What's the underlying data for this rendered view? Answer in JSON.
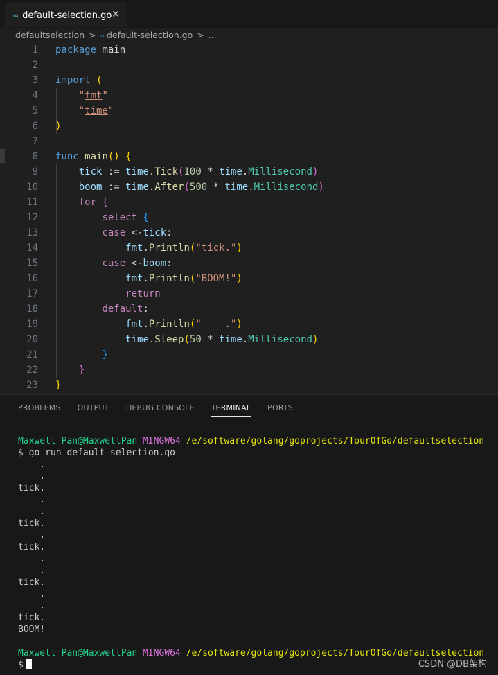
{
  "tab": {
    "icon": "go-file-icon",
    "title": "default-selection.go",
    "close": "✕"
  },
  "breadcrumb": {
    "folder": "defaultselection",
    "sep": ">",
    "file": "default-selection.go",
    "sep2": ">",
    "ellipsis": "..."
  },
  "code": [
    [
      [
        "kw",
        "package"
      ],
      [
        "op",
        " main"
      ]
    ],
    [],
    [
      [
        "kw",
        "import"
      ],
      [
        "op",
        " "
      ],
      [
        "p1",
        "("
      ]
    ],
    [
      [
        "op",
        "    "
      ],
      [
        "str",
        "\""
      ],
      [
        "strl",
        "fmt"
      ],
      [
        "str",
        "\""
      ]
    ],
    [
      [
        "op",
        "    "
      ],
      [
        "str",
        "\""
      ],
      [
        "strl",
        "time"
      ],
      [
        "str",
        "\""
      ]
    ],
    [
      [
        "p1",
        ")"
      ]
    ],
    [],
    [
      [
        "kw",
        "func"
      ],
      [
        "op",
        " "
      ],
      [
        "fn",
        "main"
      ],
      [
        "p1",
        "()"
      ],
      [
        "op",
        " "
      ],
      [
        "p1",
        "{"
      ]
    ],
    [
      [
        "op",
        "    "
      ],
      [
        "id",
        "tick"
      ],
      [
        "op",
        " := "
      ],
      [
        "id",
        "time"
      ],
      [
        "op",
        "."
      ],
      [
        "fn",
        "Tick"
      ],
      [
        "p2",
        "("
      ],
      [
        "num",
        "100"
      ],
      [
        "op",
        " * "
      ],
      [
        "id",
        "time"
      ],
      [
        "op",
        "."
      ],
      [
        "ty",
        "Millisecond"
      ],
      [
        "p2",
        ")"
      ]
    ],
    [
      [
        "op",
        "    "
      ],
      [
        "id",
        "boom"
      ],
      [
        "op",
        " := "
      ],
      [
        "id",
        "time"
      ],
      [
        "op",
        "."
      ],
      [
        "fn",
        "After"
      ],
      [
        "p2",
        "("
      ],
      [
        "num",
        "500"
      ],
      [
        "op",
        " * "
      ],
      [
        "id",
        "time"
      ],
      [
        "op",
        "."
      ],
      [
        "ty",
        "Millisecond"
      ],
      [
        "p2",
        ")"
      ]
    ],
    [
      [
        "op",
        "    "
      ],
      [
        "ctl",
        "for"
      ],
      [
        "op",
        " "
      ],
      [
        "p2",
        "{"
      ]
    ],
    [
      [
        "op",
        "        "
      ],
      [
        "ctl",
        "select"
      ],
      [
        "op",
        " "
      ],
      [
        "p3",
        "{"
      ]
    ],
    [
      [
        "op",
        "        "
      ],
      [
        "ctl",
        "case"
      ],
      [
        "op",
        " <-"
      ],
      [
        "id",
        "tick"
      ],
      [
        "op",
        ":"
      ]
    ],
    [
      [
        "op",
        "            "
      ],
      [
        "id",
        "fmt"
      ],
      [
        "op",
        "."
      ],
      [
        "fn",
        "Println"
      ],
      [
        "p1",
        "("
      ],
      [
        "str",
        "\"tick.\""
      ],
      [
        "p1",
        ")"
      ]
    ],
    [
      [
        "op",
        "        "
      ],
      [
        "ctl",
        "case"
      ],
      [
        "op",
        " <-"
      ],
      [
        "id",
        "boom"
      ],
      [
        "op",
        ":"
      ]
    ],
    [
      [
        "op",
        "            "
      ],
      [
        "id",
        "fmt"
      ],
      [
        "op",
        "."
      ],
      [
        "fn",
        "Println"
      ],
      [
        "p1",
        "("
      ],
      [
        "str",
        "\"BOOM!\""
      ],
      [
        "p1",
        ")"
      ]
    ],
    [
      [
        "op",
        "            "
      ],
      [
        "ctl",
        "return"
      ]
    ],
    [
      [
        "op",
        "        "
      ],
      [
        "ctl",
        "default"
      ],
      [
        "op",
        ":"
      ]
    ],
    [
      [
        "op",
        "            "
      ],
      [
        "id",
        "fmt"
      ],
      [
        "op",
        "."
      ],
      [
        "fn",
        "Println"
      ],
      [
        "p1",
        "("
      ],
      [
        "str",
        "\"    .\""
      ],
      [
        "p1",
        ")"
      ]
    ],
    [
      [
        "op",
        "            "
      ],
      [
        "id",
        "time"
      ],
      [
        "op",
        "."
      ],
      [
        "fn",
        "Sleep"
      ],
      [
        "p1",
        "("
      ],
      [
        "num",
        "50"
      ],
      [
        "op",
        " * "
      ],
      [
        "id",
        "time"
      ],
      [
        "op",
        "."
      ],
      [
        "ty",
        "Millisecond"
      ],
      [
        "p1",
        ")"
      ]
    ],
    [
      [
        "op",
        "        "
      ],
      [
        "p3",
        "}"
      ]
    ],
    [
      [
        "op",
        "    "
      ],
      [
        "p2",
        "}"
      ]
    ],
    [
      [
        "p1",
        "}"
      ]
    ]
  ],
  "panel": {
    "tabs": [
      {
        "id": "problems",
        "label": "PROBLEMS",
        "active": false
      },
      {
        "id": "output",
        "label": "OUTPUT",
        "active": false
      },
      {
        "id": "debug-console",
        "label": "DEBUG CONSOLE",
        "active": false
      },
      {
        "id": "terminal",
        "label": "TERMINAL",
        "active": true
      },
      {
        "id": "ports",
        "label": "PORTS",
        "active": false
      }
    ]
  },
  "terminal": {
    "prompt": {
      "user": "Maxwell Pan@MaxwellPan",
      "host": "MINGW64",
      "path": "/e/software/golang/goprojects/TourOfGo/defaultselection"
    },
    "command": "$ go run default-selection.go",
    "output": [
      "    .",
      "    .",
      "tick.",
      "    .",
      "    .",
      "tick.",
      "    .",
      "tick.",
      "    .",
      "    .",
      "tick.",
      "    .",
      "    .",
      "tick.",
      "BOOM!"
    ],
    "final_prompt": "$"
  },
  "watermark": "CSDN @DB架构"
}
